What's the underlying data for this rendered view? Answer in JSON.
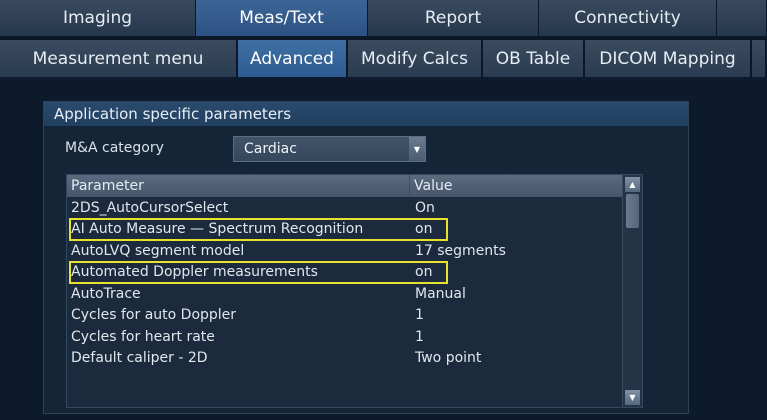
{
  "top_tabs": [
    "Imaging",
    "Meas/Text",
    "Report",
    "Connectivity"
  ],
  "top_active": "Meas/Text",
  "sub_tabs": [
    "Measurement menu",
    "Advanced",
    "Modify Calcs",
    "OB Table",
    "DICOM Mapping"
  ],
  "sub_active": "Advanced",
  "group": {
    "title": "Application specific parameters",
    "category_label": "M&A category",
    "category_value": "Cardiac"
  },
  "table": {
    "headers": {
      "parameter": "Parameter",
      "value": "Value"
    },
    "rows": [
      {
        "parameter": "2DS_AutoCursorSelect",
        "value": "On",
        "highlighted": false
      },
      {
        "parameter": "AI Auto Measure — Spectrum Recognition",
        "value": "on",
        "highlighted": true
      },
      {
        "parameter": "AutoLVQ segment model",
        "value": "17 segments",
        "highlighted": false
      },
      {
        "parameter": "Automated Doppler measurements",
        "value": "on",
        "highlighted": true
      },
      {
        "parameter": "AutoTrace",
        "value": "Manual",
        "highlighted": false
      },
      {
        "parameter": "Cycles for auto Doppler",
        "value": "1",
        "highlighted": false
      },
      {
        "parameter": "Cycles for heart rate",
        "value": "1",
        "highlighted": false
      },
      {
        "parameter": "Default caliper - 2D",
        "value": "Two point",
        "highlighted": false
      }
    ]
  },
  "colors": {
    "highlight": "#e8e22e",
    "active_tab": "#2e5c92"
  },
  "icons": {
    "dropdown": "chevron-down-icon",
    "scroll_up": "arrow-up-icon",
    "scroll_down": "arrow-down-icon"
  }
}
